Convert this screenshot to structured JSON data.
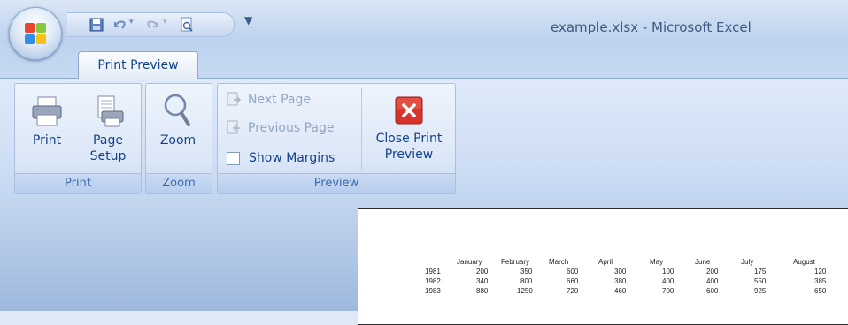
{
  "window": {
    "title": "example.xlsx - Microsoft Excel"
  },
  "quick_access": {
    "icons": [
      "save-icon",
      "undo-icon",
      "undo-dropdown-icon",
      "redo-icon",
      "redo-dropdown-icon",
      "print-preview-icon"
    ],
    "customize_glyph": "▼"
  },
  "tabs": [
    {
      "label": "Print Preview",
      "selected": true
    }
  ],
  "groups": {
    "print": {
      "label": "Print",
      "buttons": {
        "print": "Print",
        "page_setup_1": "Page",
        "page_setup_2": "Setup"
      }
    },
    "zoom": {
      "label": "Zoom",
      "buttons": {
        "zoom": "Zoom"
      }
    },
    "preview": {
      "label": "Preview",
      "next_page": "Next Page",
      "previous_page": "Previous Page",
      "show_margins": "Show Margins",
      "close_1": "Close Print",
      "close_2": "Preview"
    }
  },
  "sheet": {
    "headers": [
      "January",
      "February",
      "March",
      "April",
      "May",
      "June",
      "July",
      "August"
    ],
    "rows": [
      {
        "year": "1981",
        "values": [
          "200",
          "350",
          "600",
          "300",
          "100",
          "200",
          "175",
          "120"
        ]
      },
      {
        "year": "1982",
        "values": [
          "340",
          "800",
          "660",
          "380",
          "400",
          "400",
          "550",
          "385"
        ]
      },
      {
        "year": "1983",
        "values": [
          "880",
          "1250",
          "720",
          "460",
          "700",
          "600",
          "925",
          "650"
        ]
      }
    ]
  },
  "colors": {
    "close_red": "#d9342b",
    "ribbon_text": "#15428b",
    "disabled_text": "#93a7c4"
  }
}
